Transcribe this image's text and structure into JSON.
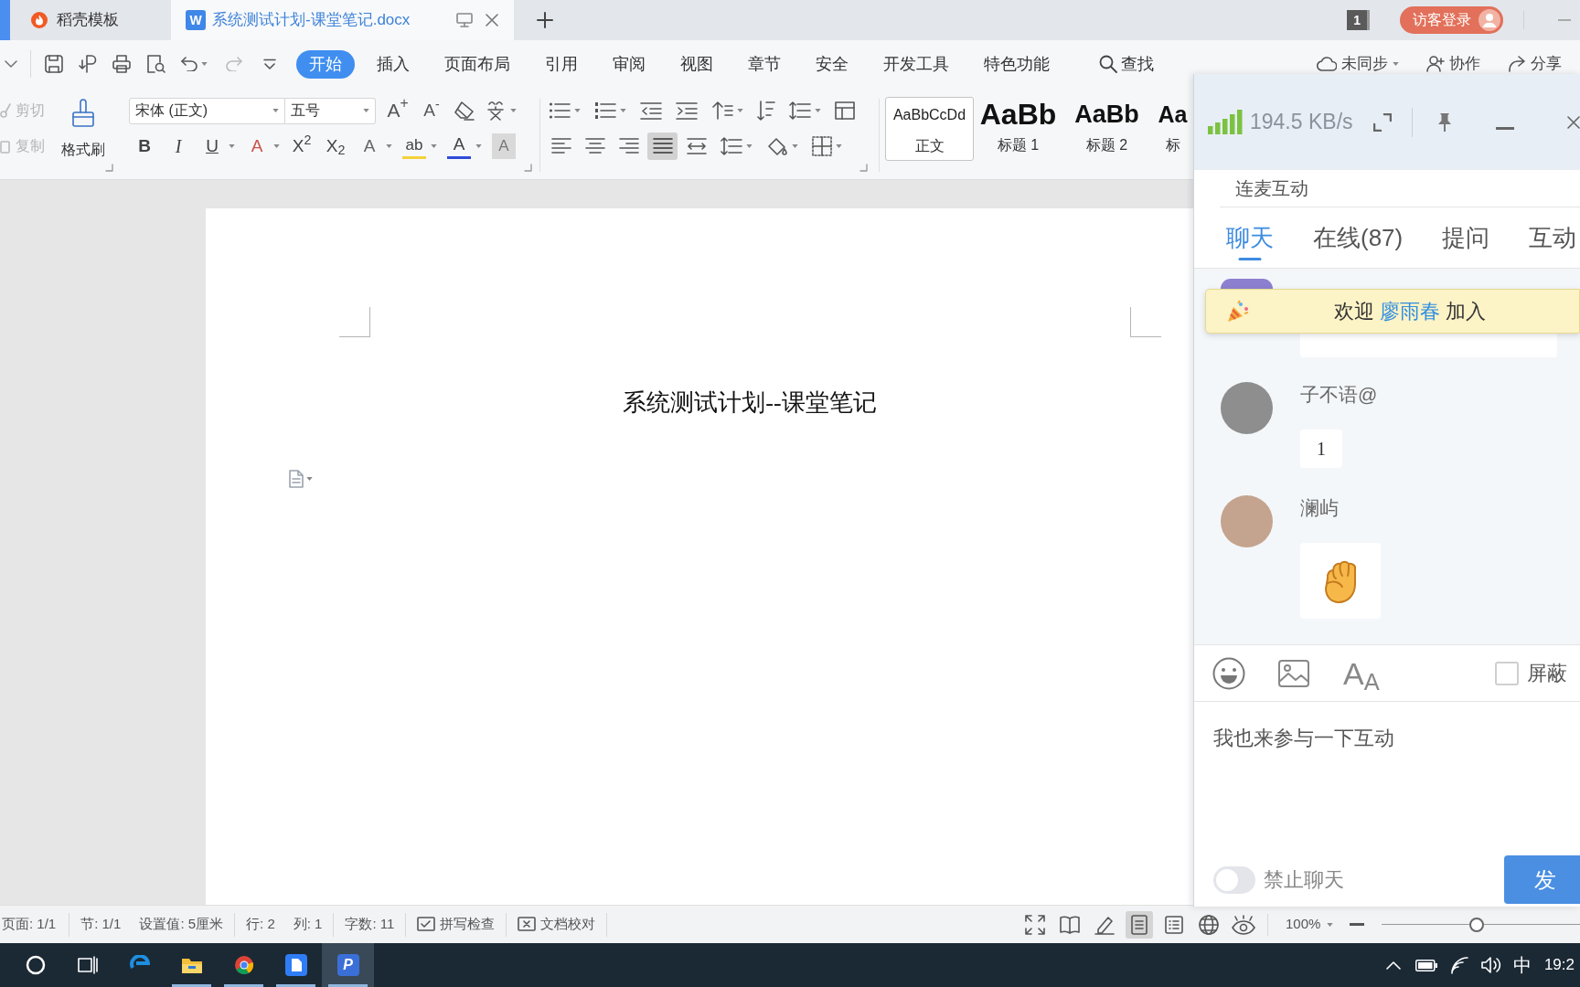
{
  "title_bar": {
    "tabs": [
      {
        "kind": "templates",
        "label": "稻壳模板",
        "selected": false
      },
      {
        "kind": "document",
        "glyph": "W",
        "label": "系统测试计划-课堂笔记.docx",
        "selected": true
      }
    ],
    "window_count": "1",
    "login_button": "访客登录"
  },
  "menu": {
    "tabs": [
      {
        "label": "开始",
        "selected": true
      },
      {
        "label": "插入",
        "selected": false
      },
      {
        "label": "页面布局",
        "selected": false
      },
      {
        "label": "引用",
        "selected": false
      },
      {
        "label": "审阅",
        "selected": false
      },
      {
        "label": "视图",
        "selected": false
      },
      {
        "label": "章节",
        "selected": false
      },
      {
        "label": "安全",
        "selected": false
      },
      {
        "label": "开发工具",
        "selected": false
      },
      {
        "label": "特色功能",
        "selected": false
      }
    ],
    "search": "查找",
    "actions": [
      {
        "kind": "sync",
        "label": "未同步",
        "dropdown": true
      },
      {
        "kind": "collaborate",
        "label": "协作",
        "dropdown": false
      },
      {
        "kind": "share",
        "label": "分享",
        "dropdown": false
      }
    ]
  },
  "ribbon": {
    "clipboard": [
      {
        "kind": "cut",
        "label": "剪切",
        "disabled": true
      },
      {
        "kind": "copy",
        "label": "复制",
        "disabled": true
      }
    ],
    "format_painter": "格式刷",
    "font": {
      "family": "宋体 (正文)",
      "size": "五号"
    },
    "size_buttons": [
      {
        "kind": "grow",
        "glyph": "A$^{+}$"
      },
      {
        "kind": "shrink",
        "glyph": "A$^{-}$"
      }
    ],
    "format_buttons": [
      {
        "kind": "bold",
        "glyph": "B",
        "dropdown": false
      },
      {
        "kind": "italic",
        "glyph": "I",
        "dropdown": false
      },
      {
        "kind": "underline",
        "glyph": "U",
        "dropdown": true
      },
      {
        "kind": "strikethrough",
        "glyph": "A",
        "dropdown": true
      },
      {
        "kind": "superscript",
        "glyph": "X$^{2}$",
        "dropdown": false
      },
      {
        "kind": "subscript",
        "glyph": "X$_{2}$",
        "dropdown": false
      },
      {
        "kind": "outline",
        "glyph": "A",
        "dropdown": true
      },
      {
        "kind": "highlight",
        "glyph": "ab",
        "dropdown": true
      },
      {
        "kind": "font_color",
        "glyph": "A",
        "dropdown": true
      },
      {
        "kind": "shading",
        "glyph": "A",
        "dropdown": false
      }
    ],
    "alignment": [
      {
        "kind": "left",
        "selected": false
      },
      {
        "kind": "center",
        "selected": false
      },
      {
        "kind": "right",
        "selected": false
      },
      {
        "kind": "justify",
        "selected": true
      },
      {
        "kind": "distributed",
        "selected": false
      }
    ],
    "styles": [
      {
        "kind": "body",
        "sample": "AaBbCcDd",
        "label": "正文",
        "selected": true
      },
      {
        "kind": "heading1",
        "sample": "AaBb",
        "label": "标题 1",
        "selected": false
      },
      {
        "kind": "heading2",
        "sample": "AaBb",
        "label": "标题 2",
        "selected": false
      },
      {
        "kind": "heading3",
        "sample": "Aa",
        "label": "标",
        "selected": false
      }
    ]
  },
  "document": {
    "title": "系统测试计划--课堂笔记"
  },
  "live_panel": {
    "speed": "194.5 KB/s",
    "section": "连麦互动",
    "tabs": [
      {
        "label": "聊天",
        "selected": true
      },
      {
        "label": "在线(87)",
        "selected": false
      },
      {
        "label": "提问",
        "selected": false
      },
      {
        "label": "互动",
        "selected": false
      }
    ],
    "welcome": {
      "before": "欢迎",
      "name": "廖雨春",
      "after": "加入"
    },
    "messages": [
      {
        "kind": "text",
        "user": "子不语@",
        "text": "1"
      },
      {
        "kind": "emoji",
        "user": "澜屿"
      }
    ],
    "font_button": "A$_{A}$",
    "block": {
      "label": "屏蔽",
      "checked": false
    },
    "input": {
      "value": "我也来参与一下互动"
    },
    "mute": {
      "label": "禁止聊天",
      "on": false
    },
    "send_button": "发"
  },
  "status_bar": {
    "groups": [
      [
        "页面: 1/1"
      ],
      [
        "节: 1/1",
        "设置值: 5厘米"
      ],
      [
        "行: 2",
        "列: 1"
      ],
      [
        "字数: 11"
      ]
    ],
    "tools": [
      {
        "kind": "spell_check",
        "label": "拼写检查"
      },
      {
        "kind": "proofread",
        "label": "文档校对"
      }
    ],
    "views": [
      {
        "kind": "fullscreen",
        "selected": false
      },
      {
        "kind": "reading",
        "selected": false
      },
      {
        "kind": "edit",
        "selected": false
      },
      {
        "kind": "page",
        "selected": true
      },
      {
        "kind": "outline",
        "selected": false
      },
      {
        "kind": "web",
        "selected": false
      },
      {
        "kind": "eye_care",
        "selected": false
      }
    ],
    "zoom": {
      "value": "100%",
      "level": 0.48
    }
  },
  "taskbar": {
    "apps": [
      {
        "kind": "edge",
        "running": false,
        "selected": false
      },
      {
        "kind": "explorer",
        "running": true,
        "selected": false
      },
      {
        "kind": "chrome",
        "running": true,
        "selected": false
      },
      {
        "kind": "wps",
        "running": true,
        "selected": false
      },
      {
        "kind": "letter_tile",
        "glyph": "P",
        "running": true,
        "selected": true
      }
    ],
    "ime": "中",
    "time": "19:2"
  }
}
